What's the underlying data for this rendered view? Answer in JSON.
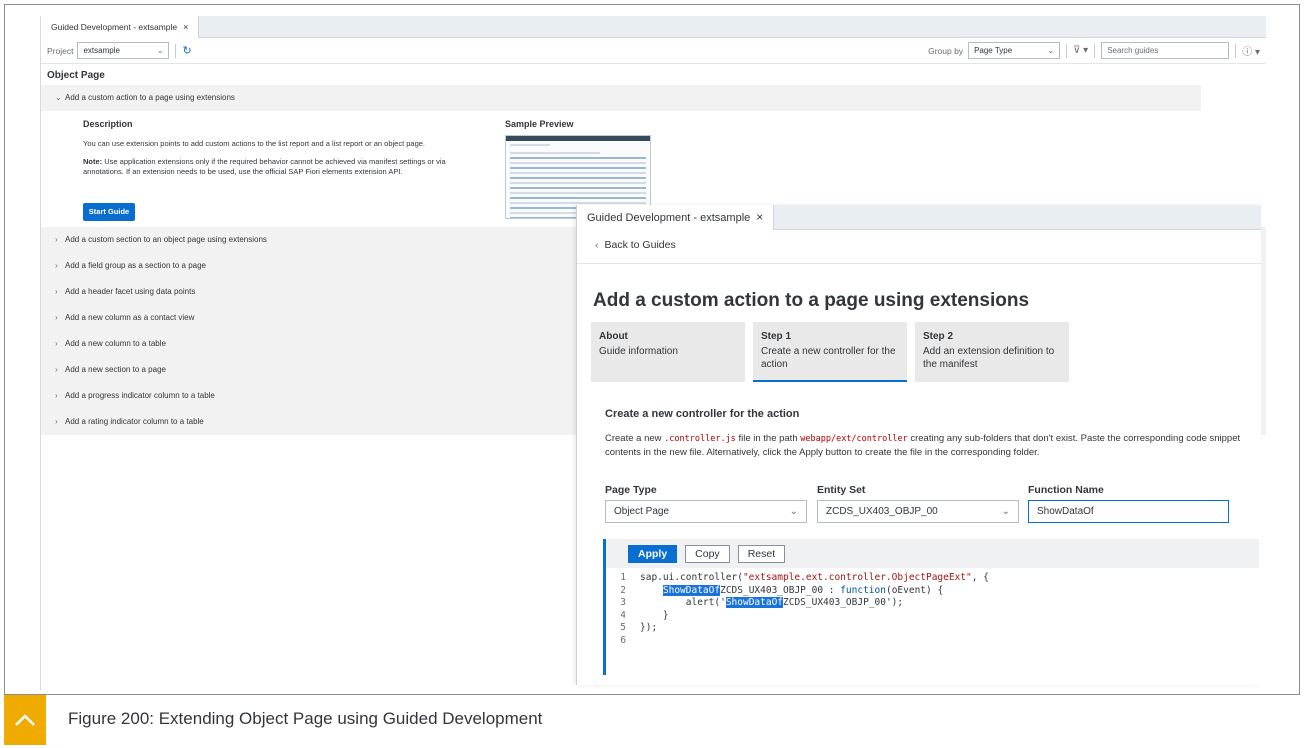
{
  "back_window": {
    "tab_title": "Guided Development - extsample",
    "tab_close": "×",
    "project_label": "Project",
    "project_value": "extsample",
    "group_by_label": "Group by",
    "group_by_value": "Page Type",
    "search_placeholder": "Search guides",
    "section_title": "Object Page",
    "expanded_item": "Add a custom action to a page using extensions",
    "description_heading": "Description",
    "description_text": "You can use extension points to add custom actions to the list report and a list report or an object page.",
    "note_label": "Note:",
    "note_text": " Use application extensions only if the required behavior cannot be achieved via manifest settings or via annotations. If an extension needs to be used, use the official SAP Fiori elements extension API.",
    "start_guide_label": "Start Guide",
    "sample_preview_heading": "Sample Preview",
    "items": [
      "Add a custom section to an object page using extensions",
      "Add a field group as a section to a page",
      "Add a header facet using data points",
      "Add a new column as a contact view",
      "Add a new column to a table",
      "Add a new section to a page",
      "Add a progress indicator column to a table",
      "Add a rating indicator column to a table"
    ]
  },
  "front_window": {
    "tab_title": "Guided Development - extsample",
    "tab_close": "×",
    "back_link": "Back to Guides",
    "guide_title": "Add a custom action to a page using extensions",
    "steps": [
      {
        "title": "About",
        "subtitle": "Guide information"
      },
      {
        "title": "Step 1",
        "subtitle": "Create a new controller for the action"
      },
      {
        "title": "Step 2",
        "subtitle": "Add an extension definition to the manifest"
      }
    ],
    "section_title": "Create a new controller for the action",
    "desc_part1": "Create a new ",
    "desc_code1": ".controller.js",
    "desc_part2": " file in the path ",
    "desc_code2": "webapp/ext/controller",
    "desc_part3": " creating any sub-folders that don't exist. Paste the corresponding code snippet contents in the new file. Alternatively, click the Apply button to create the file in the corresponding folder.",
    "page_type_label": "Page Type",
    "page_type_value": "Object Page",
    "entity_set_label": "Entity Set",
    "entity_set_value": "ZCDS_UX403_OBJP_00",
    "function_name_label": "Function Name",
    "function_name_value": "ShowDataOf",
    "apply_label": "Apply",
    "copy_label": "Copy",
    "reset_label": "Reset",
    "code": {
      "line1_prefix": "sap.ui.controller(",
      "line1_str": "\"extsample.ext.controller.ObjectPageExt\"",
      "line1_suffix": ", {",
      "line2_hl": "ShowDataOf",
      "line2_rest": "ZCDS_UX403_OBJP_00 : ",
      "line2_kw": "function",
      "line2_end": "(oEvent) {",
      "line3_pre": "alert('",
      "line3_hl": "ShowDataOf",
      "line3_rest": "ZCDS_UX403_OBJP_00');",
      "line4": "}",
      "line5": "});",
      "line6": "",
      "numbers": [
        "1",
        "2",
        "3",
        "4",
        "5",
        "6"
      ]
    }
  },
  "caption": {
    "text": "Figure 200: Extending Object Page using Guided Development"
  }
}
